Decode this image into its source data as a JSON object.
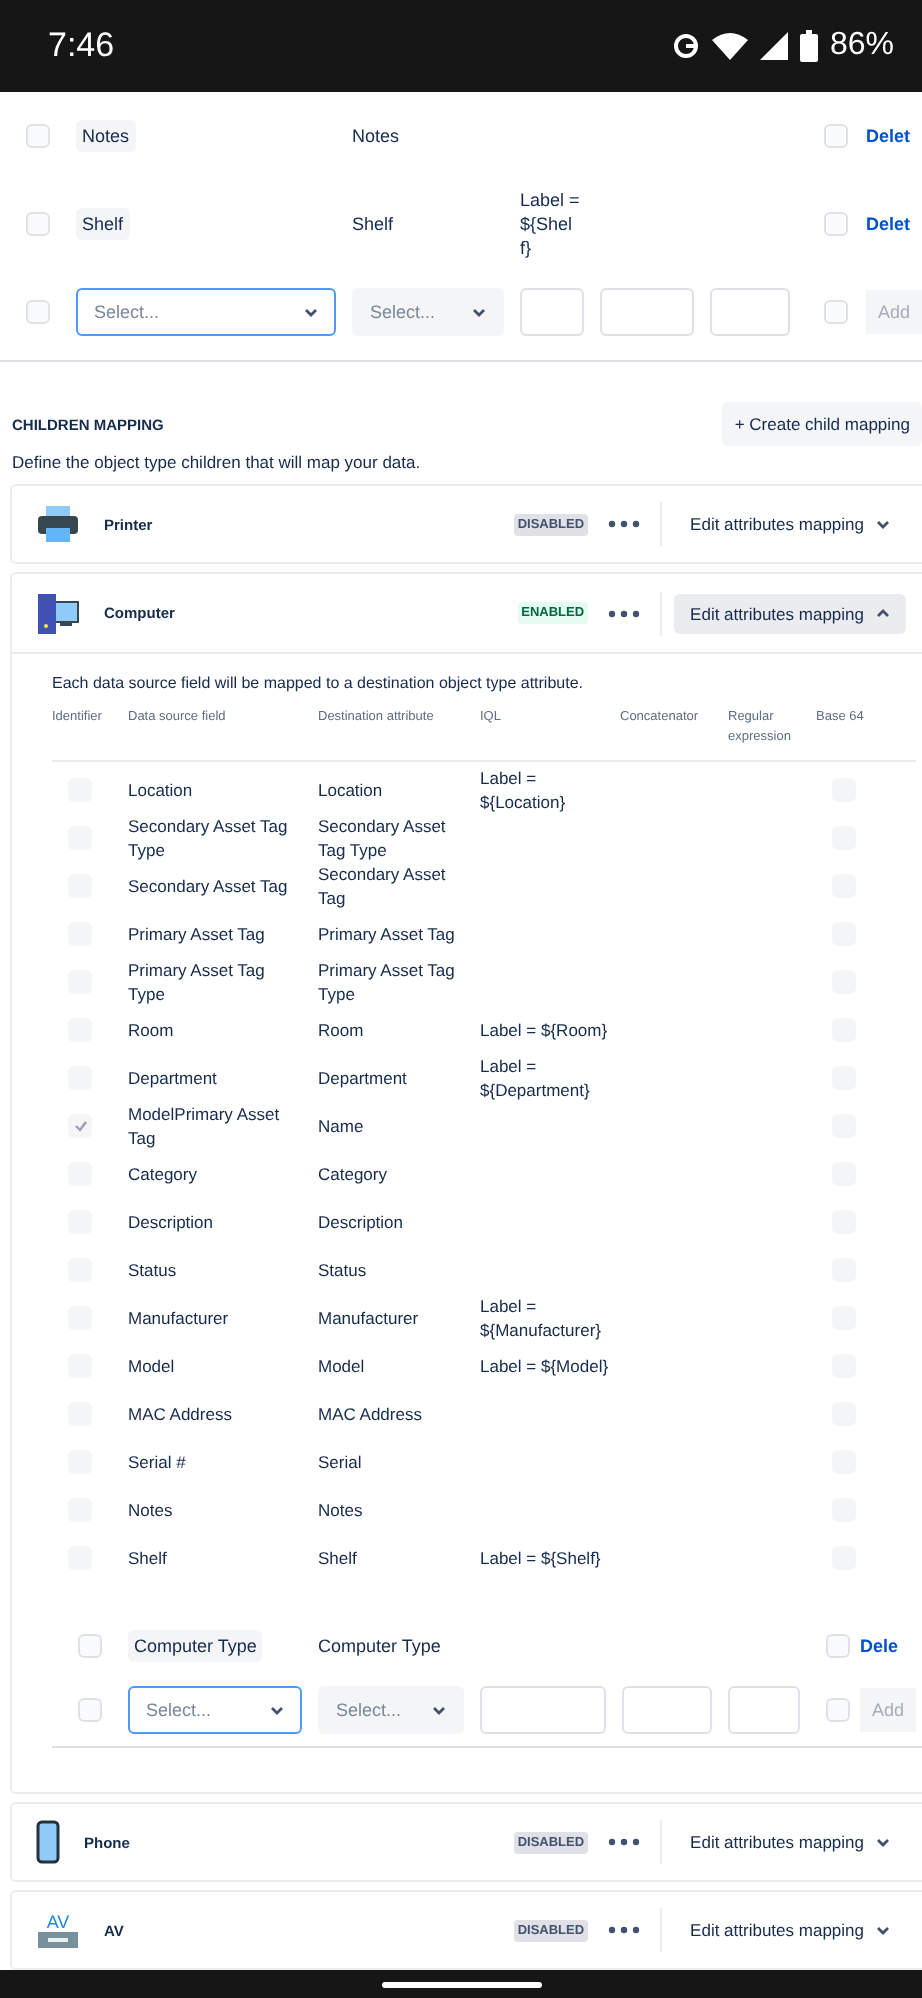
{
  "status_bar": {
    "time": "7:46",
    "battery": "86%"
  },
  "top_mapping": {
    "rows": [
      {
        "kind": "mapped",
        "source": "Notes",
        "destination": "Notes",
        "iql": "",
        "identifier": false,
        "base64": false,
        "action": "Delet"
      },
      {
        "kind": "mapped",
        "source": "Shelf",
        "destination": "Shelf",
        "iql": "Label = ${Shelf}",
        "identifier": false,
        "base64": false,
        "action": "Delet"
      },
      {
        "kind": "new",
        "source_placeholder": "Select...",
        "source_focused": true,
        "destination_placeholder": "Select...",
        "identifier": false,
        "base64": false,
        "action": "Add"
      }
    ]
  },
  "children_mapping": {
    "heading": "CHILDREN MAPPING",
    "create_button": "+ Create child mapping",
    "description": "Define the object type children that will map your data.",
    "children": [
      {
        "name": "Printer",
        "status": "DISABLED",
        "enabled": false,
        "expanded": false,
        "edit_button": "Edit attributes mapping"
      },
      {
        "name": "Computer",
        "status": "ENABLED",
        "enabled": true,
        "expanded": true,
        "edit_button": "Edit attributes mapping",
        "intro": "Each data source field will be mapped to a destination object type attribute.",
        "columns": [
          "Identifier",
          "Data source field",
          "Destination attribute",
          "IQL",
          "Concatenator",
          "Regular expression",
          "Base 64"
        ],
        "rows": [
          {
            "source": "Location",
            "destination": "Location",
            "iql": "Label = ${Location}",
            "identifier": false,
            "base64": false
          },
          {
            "source": "Secondary Asset Tag Type",
            "destination": "Secondary Asset Tag Type",
            "iql": "",
            "identifier": false,
            "base64": false
          },
          {
            "source": "Secondary Asset Tag",
            "destination": "Secondary Asset Tag",
            "iql": "",
            "identifier": false,
            "base64": false
          },
          {
            "source": "Primary Asset Tag",
            "destination": "Primary Asset Tag",
            "iql": "",
            "identifier": false,
            "base64": false
          },
          {
            "source": "Primary Asset Tag Type",
            "destination": "Primary Asset Tag Type",
            "iql": "",
            "identifier": false,
            "base64": false
          },
          {
            "source": "Room",
            "destination": "Room",
            "iql": "Label = ${Room}",
            "identifier": false,
            "base64": false
          },
          {
            "source": "Department",
            "destination": "Department",
            "iql": "Label = ${Department}",
            "identifier": false,
            "base64": false
          },
          {
            "source": "ModelPrimary Asset Tag",
            "destination": "Name",
            "iql": "",
            "identifier": true,
            "base64": false
          },
          {
            "source": "Category",
            "destination": "Category",
            "iql": "",
            "identifier": false,
            "base64": false
          },
          {
            "source": "Description",
            "destination": "Description",
            "iql": "",
            "identifier": false,
            "base64": false
          },
          {
            "source": "Status",
            "destination": "Status",
            "iql": "",
            "identifier": false,
            "base64": false
          },
          {
            "source": "Manufacturer",
            "destination": "Manufacturer",
            "iql": "Label = ${Manufacturer}",
            "identifier": false,
            "base64": false
          },
          {
            "source": "Model",
            "destination": "Model",
            "iql": "Label = ${Model}",
            "identifier": false,
            "base64": false
          },
          {
            "source": "MAC Address",
            "destination": "MAC Address",
            "iql": "",
            "identifier": false,
            "base64": false
          },
          {
            "source": "Serial #",
            "destination": "Serial",
            "iql": "",
            "identifier": false,
            "base64": false
          },
          {
            "source": "Notes",
            "destination": "Notes",
            "iql": "",
            "identifier": false,
            "base64": false
          },
          {
            "source": "Shelf",
            "destination": "Shelf",
            "iql": "Label = ${Shelf}",
            "identifier": false,
            "base64": false
          }
        ],
        "extra_rows": [
          {
            "kind": "mapped",
            "source": "Computer Type",
            "destination": "Computer Type",
            "iql": "",
            "identifier": false,
            "base64": false,
            "action": "Dele"
          },
          {
            "kind": "new",
            "source_placeholder": "Select...",
            "source_focused": true,
            "destination_placeholder": "Select...",
            "identifier": false,
            "base64": false,
            "action": "Add"
          }
        ]
      },
      {
        "name": "Phone",
        "status": "DISABLED",
        "enabled": false,
        "expanded": false,
        "edit_button": "Edit attributes mapping"
      },
      {
        "icon_text": "AV",
        "name": "AV",
        "status": "DISABLED",
        "enabled": false,
        "expanded": false,
        "edit_button": "Edit attributes mapping"
      }
    ]
  }
}
